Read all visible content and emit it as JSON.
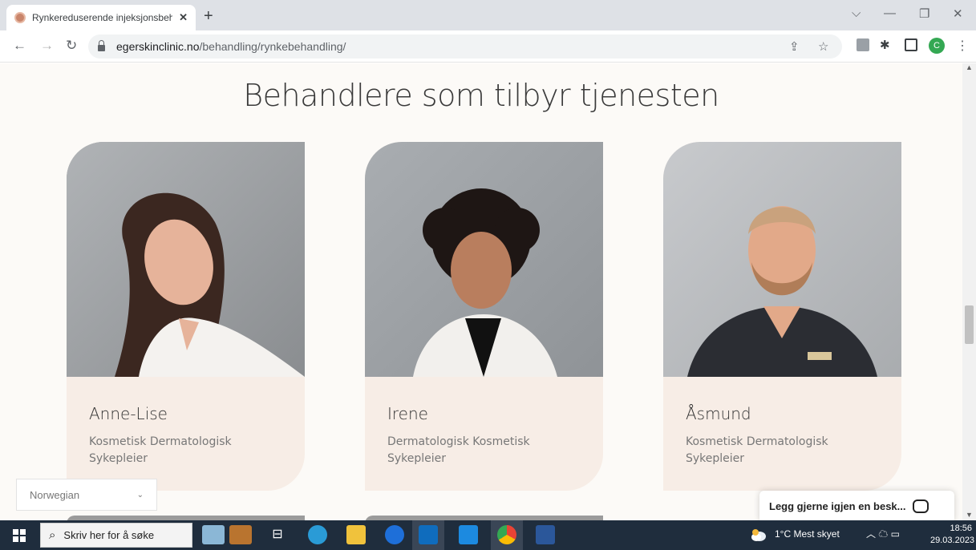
{
  "browser": {
    "tab_title": "Rynkereduserende injeksjonsbeh",
    "tab_close": "✕",
    "new_tab": "+",
    "url_domain": "egerskinclinic.no",
    "url_path": "/behandling/rynkebehandling/",
    "profile_initial": "C"
  },
  "page": {
    "heading": "Behandlere som tilbyr tjenesten",
    "practitioners": [
      {
        "name": "Anne-Lise",
        "role": "Kosmetisk Dermatologisk Sykepleier"
      },
      {
        "name": "Irene",
        "role": "Dermatologisk Kosmetisk Sykepleier"
      },
      {
        "name": "Åsmund",
        "role": "Kosmetisk Dermatologisk Sykepleier"
      }
    ],
    "language_select": {
      "value": "Norwegian"
    },
    "chat": {
      "label": "Legg gjerne igjen en besk..."
    }
  },
  "taskbar": {
    "search_placeholder": "Skriv her for å søke",
    "weather": "1°C  Mest skyet",
    "time": "18:56",
    "date": "29.03.2023"
  },
  "colors": {
    "card_bg": "#f7ede6",
    "page_bg": "#fcfaf7",
    "taskbar_bg": "#1f2d3d"
  }
}
